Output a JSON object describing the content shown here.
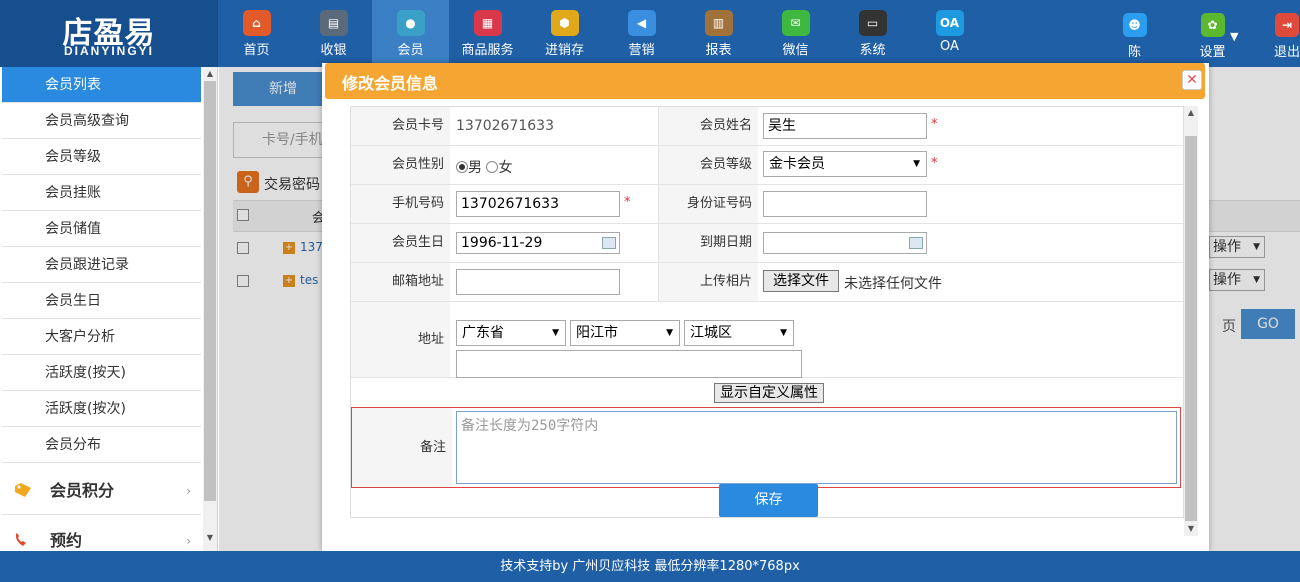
{
  "brand": {
    "logo_cn": "店盈易",
    "logo_en": "DIANYINGYI",
    "color": "#1f5fa6"
  },
  "nav": [
    {
      "label": "首页",
      "icon": "home-icon",
      "glyph": "⌂",
      "color": "#e25a2a"
    },
    {
      "label": "收银",
      "icon": "cash-register-icon",
      "glyph": "▤",
      "color": "#5a6a7a"
    },
    {
      "label": "会员",
      "icon": "member-icon",
      "glyph": "●",
      "color": "#3aa0c8",
      "active": true
    },
    {
      "label": "商品服务",
      "icon": "product-icon",
      "glyph": "▦",
      "color": "#d9384a"
    },
    {
      "label": "进销存",
      "icon": "inventory-icon",
      "glyph": "⬢",
      "color": "#e0a81a"
    },
    {
      "label": "营销",
      "icon": "megaphone-icon",
      "glyph": "◀",
      "color": "#3a8ee0"
    },
    {
      "label": "报表",
      "icon": "report-icon",
      "glyph": "▥",
      "color": "#a0723a"
    },
    {
      "label": "微信",
      "icon": "wechat-icon",
      "glyph": "✉",
      "color": "#3eb83e"
    },
    {
      "label": "系统",
      "icon": "monitor-icon",
      "glyph": "▭",
      "color": "#333"
    },
    {
      "label": "OA",
      "icon": "oa-icon",
      "glyph": "OA",
      "color": "#1e9be0"
    }
  ],
  "user": {
    "name": "陈",
    "icon": "user-icon"
  },
  "settings": {
    "label": "设置",
    "icon": "gear-icon"
  },
  "logout": {
    "label": "退出",
    "icon": "logout-icon"
  },
  "sidebar": {
    "items": [
      "会员列表",
      "会员高级查询",
      "会员等级",
      "会员挂账",
      "会员储值",
      "会员跟进记录",
      "会员生日",
      "大客户分析",
      "活跃度(按天)",
      "活跃度(按次)",
      "会员分布"
    ],
    "groups": [
      {
        "label": "会员积分",
        "icon": "tag-icon"
      },
      {
        "label": "预约",
        "icon": "phone-icon"
      }
    ]
  },
  "background": {
    "add_button": "新增",
    "search_placeholder": "卡号/手机",
    "trade_password_label": "交易密码",
    "column_head": "会",
    "rows": [
      "137",
      "tes"
    ],
    "action_label": "操作",
    "page_label": "页",
    "go_label": "GO"
  },
  "modal": {
    "title": "修改会员信息",
    "card_no_label": "会员卡号",
    "card_no": "13702671633",
    "name_label": "会员姓名",
    "name": "吴生",
    "gender_label": "会员性别",
    "gender_male": "男",
    "gender_female": "女",
    "gender_selected": "男",
    "level_label": "会员等级",
    "level": "金卡会员",
    "phone_label": "手机号码",
    "phone": "13702671633",
    "idcard_label": "身份证号码",
    "idcard": "",
    "birthday_label": "会员生日",
    "birthday": "1996-11-29",
    "expire_label": "到期日期",
    "expire": "",
    "email_label": "邮箱地址",
    "email": "",
    "photo_label": "上传相片",
    "choose_file": "选择文件",
    "no_file": "未选择任何文件",
    "address_label": "地址",
    "province": "广东省",
    "city": "阳江市",
    "district": "江城区",
    "address_detail": "",
    "custom_attr_button": "显示自定义属性",
    "remark_label": "备注",
    "remark_placeholder": "备注长度为250字符内",
    "save_button": "保存",
    "required_mark": "*"
  },
  "footer": {
    "text": "技术支持by 广州贝应科技    最低分辨率1280*768px"
  }
}
